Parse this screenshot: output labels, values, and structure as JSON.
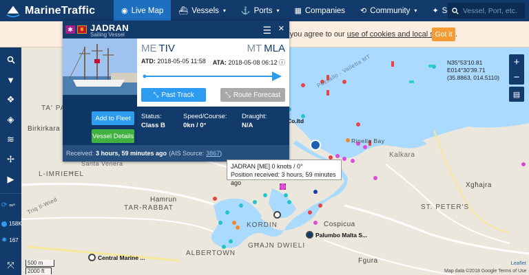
{
  "nav": {
    "brand": "MarineTraffic",
    "items": [
      {
        "label": "Live Map",
        "icon": "◉",
        "caret": ""
      },
      {
        "label": "Vessels",
        "icon": "⛴",
        "caret": "▾"
      },
      {
        "label": "Ports",
        "icon": "⚓",
        "caret": "▾"
      },
      {
        "label": "Companies",
        "icon": "▦",
        "caret": ""
      },
      {
        "label": "Community",
        "icon": "⟲",
        "caret": "▾"
      },
      {
        "label": "Solutions",
        "icon": "✦",
        "caret": "▾"
      }
    ],
    "search_placeholder": "Vessel, Port, etc."
  },
  "cookie": {
    "text_prefix": "es, you agree to our",
    "link": "use of cookies and local storage",
    "text_suffix": ".",
    "button": "Got it"
  },
  "sidebar": {
    "stats": [
      {
        "label": "∞ⁿ"
      },
      {
        "label": "158K"
      },
      {
        "label": "167"
      }
    ]
  },
  "coords": {
    "lat": "N35°53'10.81",
    "lon": "E014°30'39.71",
    "decimal": "(35.8863, 014.5110)"
  },
  "popup": {
    "vessel_name": "JADRAN",
    "vessel_type": "Sailing Vessel",
    "from_cc": "ME",
    "from_port": "TIV",
    "to_cc": "MT",
    "to_port": "MLA",
    "atd_label": "ATD:",
    "atd_value": "2018-05-05 11:58",
    "ata_label": "ATA:",
    "ata_value": "2018-05-08 06:12",
    "past_track": "Past Track",
    "route_forecast": "Route Forecast",
    "add_to_fleet": "Add to Fleet",
    "vessel_details": "Vessel Details",
    "status_label": "Status:",
    "status_value": "Class B",
    "speed_label": "Speed/Course:",
    "speed_value": "0kn / 0°",
    "draught_label": "Draught:",
    "draught_value": "N/A",
    "received_label": "Received:",
    "received_value": "3 hours, 59 minutes ago",
    "ais_prefix": "(AIS Source:",
    "ais_source": "3867",
    "ais_suffix": ")"
  },
  "tooltip": {
    "line1": "JADRAN [ME] 0 knots / 0°",
    "line2": "Position received: 3 hours, 59 minutes ago"
  },
  "map_labels": {
    "ta_paceville": "TA' PACE",
    "birkirkara": "Birkirkara",
    "santa_venera": "Santa Venera",
    "l_imrieh": "L-IMRIEĦEL",
    "hamrun": "Hamrun",
    "tar_rabbat": "TAR-RABBAT",
    "kordin": "KORDIN",
    "cospicua": "Cospicua",
    "ghajn_dwieli": "GĦAJN DWIELI",
    "albertown": "ALBERTOWN",
    "st_peters": "ST. PETER'S",
    "kalkara": "Kalkara",
    "rinella_bay": "Rinella Bay",
    "xghajra": "Xgħajra",
    "valletta": "Valletta",
    "fgura": "Fgura",
    "pozzallo": "Pozzallo - Valletta MT",
    "triq_il_wied": "Triq Il-Wied",
    "central_marine": "Central Marine ...",
    "palumbo": "Palumbo Malta S...",
    "co_ltd": "Co.ltd"
  },
  "scale": {
    "metric": "500 m",
    "imperial": "2000 ft"
  },
  "attribution": "Map data ©2018 Google   Terms of Use",
  "leaflet": "Leaflet"
}
